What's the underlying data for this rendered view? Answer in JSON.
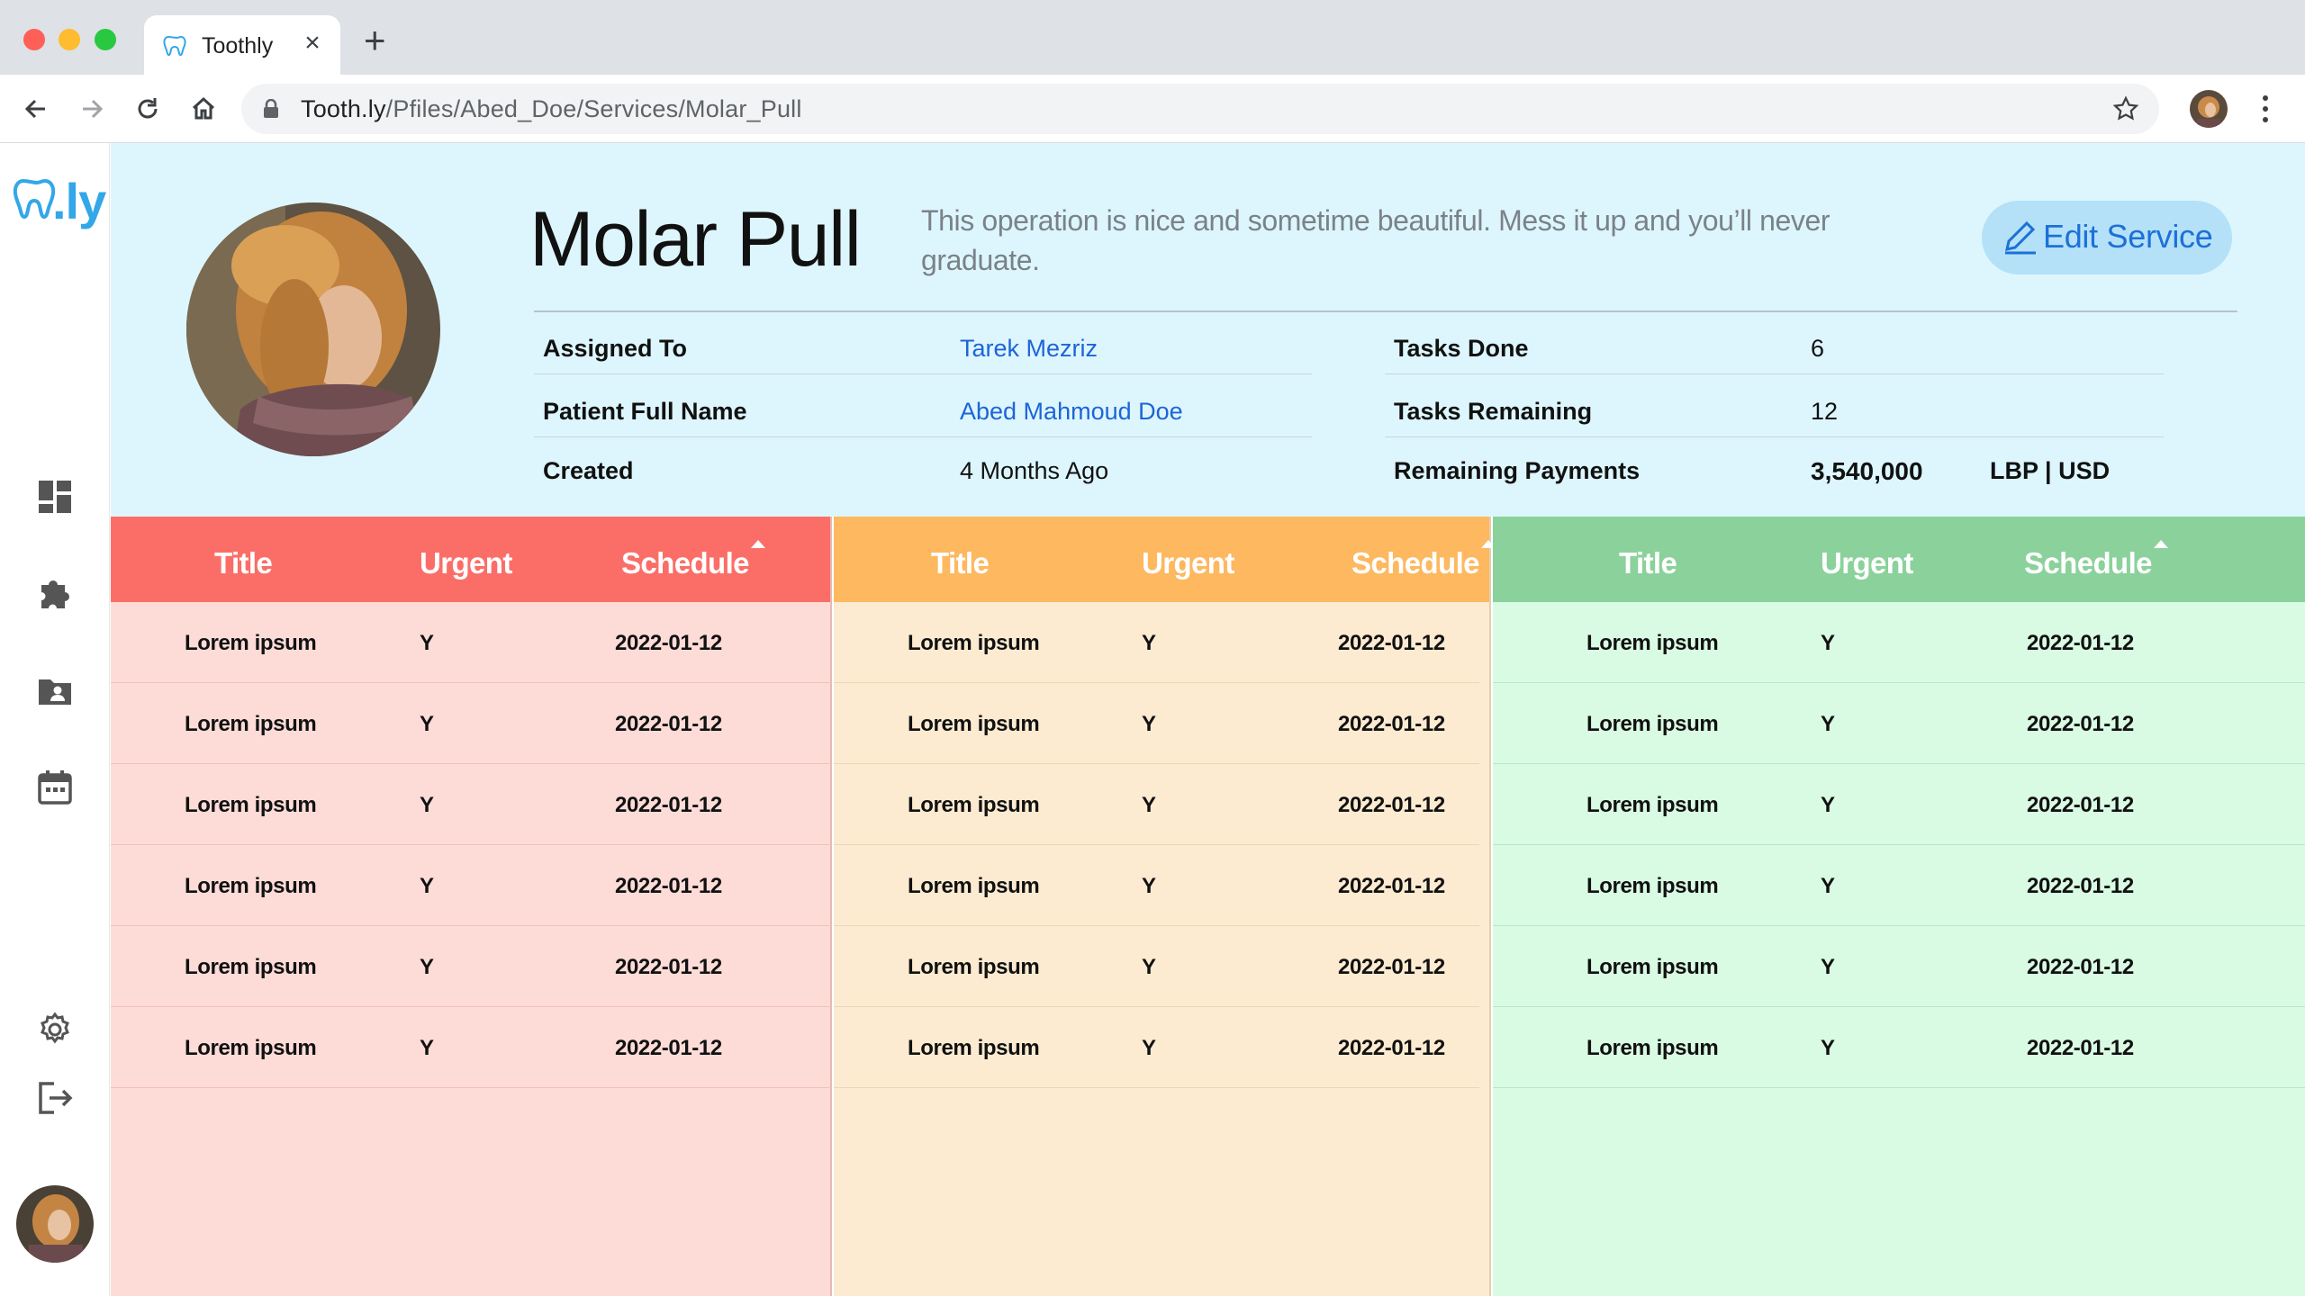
{
  "browser": {
    "tab_title": "Toothly",
    "url_host": "Tooth.ly",
    "url_path": "/Pfiles/Abed_Doe/Services/Molar_Pull"
  },
  "sidebar": {
    "logo_text": ".ly",
    "icons": [
      "dashboard-icon",
      "puzzle-icon",
      "patient-folder-icon",
      "calendar-icon",
      "gear-icon",
      "logout-icon"
    ]
  },
  "service": {
    "title": "Molar Pull",
    "description": "This operation is nice and sometime beautiful. Mess it up and you’ll never graduate.",
    "edit_label": "Edit Service"
  },
  "info": {
    "assigned_label": "Assigned To",
    "assigned_value": "Tarek Mezriz",
    "patient_label": "Patient Full Name",
    "patient_value": "Abed Mahmoud Doe",
    "created_label": "Created",
    "created_value": "4 Months Ago",
    "tasks_done_label": "Tasks Done",
    "tasks_done_value": "6",
    "tasks_remaining_label": "Tasks Remaining",
    "tasks_remaining_value": "12",
    "payments_label": "Remaining Payments",
    "payments_value": "3,540,000",
    "payments_currency": "LBP | USD"
  },
  "tables": {
    "headers": {
      "title": "Title",
      "urgent": "Urgent",
      "schedule": "Schedule"
    },
    "red": {
      "color": "#fb6e68",
      "rows": [
        {
          "title": "Lorem ipsum",
          "urgent": "Y",
          "schedule": "2022-01-12"
        },
        {
          "title": "Lorem ipsum",
          "urgent": "Y",
          "schedule": "2022-01-12"
        },
        {
          "title": "Lorem ipsum",
          "urgent": "Y",
          "schedule": "2022-01-12"
        },
        {
          "title": "Lorem ipsum",
          "urgent": "Y",
          "schedule": "2022-01-12"
        },
        {
          "title": "Lorem ipsum",
          "urgent": "Y",
          "schedule": "2022-01-12"
        },
        {
          "title": "Lorem ipsum",
          "urgent": "Y",
          "schedule": "2022-01-12"
        }
      ]
    },
    "orange": {
      "color": "#fdb860",
      "rows": [
        {
          "title": "Lorem ipsum",
          "urgent": "Y",
          "schedule": "2022-01-12"
        },
        {
          "title": "Lorem ipsum",
          "urgent": "Y",
          "schedule": "2022-01-12"
        },
        {
          "title": "Lorem ipsum",
          "urgent": "Y",
          "schedule": "2022-01-12"
        },
        {
          "title": "Lorem ipsum",
          "urgent": "Y",
          "schedule": "2022-01-12"
        },
        {
          "title": "Lorem ipsum",
          "urgent": "Y",
          "schedule": "2022-01-12"
        },
        {
          "title": "Lorem ipsum",
          "urgent": "Y",
          "schedule": "2022-01-12"
        }
      ]
    },
    "green": {
      "color": "#8bd19b",
      "rows": [
        {
          "title": "Lorem ipsum",
          "urgent": "Y",
          "schedule": "2022-01-12"
        },
        {
          "title": "Lorem ipsum",
          "urgent": "Y",
          "schedule": "2022-01-12"
        },
        {
          "title": "Lorem ipsum",
          "urgent": "Y",
          "schedule": "2022-01-12"
        },
        {
          "title": "Lorem ipsum",
          "urgent": "Y",
          "schedule": "2022-01-12"
        },
        {
          "title": "Lorem ipsum",
          "urgent": "Y",
          "schedule": "2022-01-12"
        },
        {
          "title": "Lorem ipsum",
          "urgent": "Y",
          "schedule": "2022-01-12"
        }
      ]
    }
  }
}
